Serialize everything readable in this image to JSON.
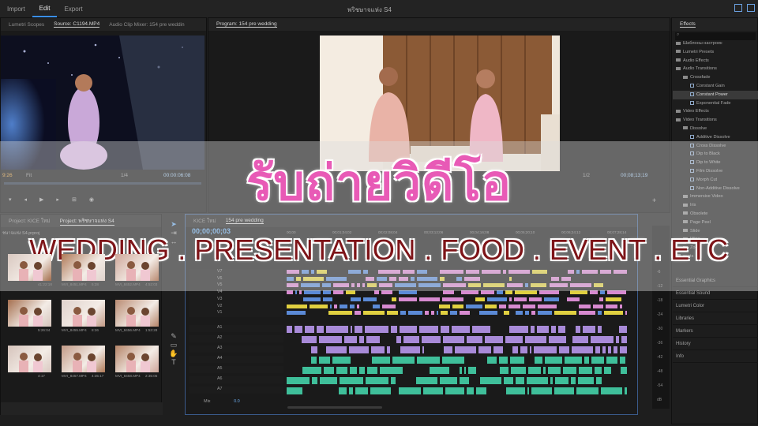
{
  "menu": {
    "items": [
      "Import",
      "Edit",
      "Export"
    ],
    "doc_title": "พริชษาจแห่ง S4"
  },
  "source_panel": {
    "tabs": [
      "Lumetri Scopes",
      "Source: C1194.MP4",
      "Audio Clip Mixer: 154 pre weddin"
    ],
    "timecode_left": "9:26",
    "fit": "Fit",
    "ratio": "1/4",
    "timecode_right": "00:00:06:08"
  },
  "program_panel": {
    "tab": "Program: 154 pre wedding",
    "ratio": "1/2",
    "timecode_right": "00;08;13;19"
  },
  "effects_panel": {
    "title": "Effects",
    "items": [
      {
        "label": "Шаблоны настроек",
        "kind": "folder",
        "indent": 0
      },
      {
        "label": "Lumetri Presets",
        "kind": "folder",
        "indent": 0
      },
      {
        "label": "Audio Effects",
        "kind": "folder",
        "indent": 0
      },
      {
        "label": "Audio Transitions",
        "kind": "folder",
        "indent": 0
      },
      {
        "label": "Crossfade",
        "kind": "folder",
        "indent": 1
      },
      {
        "label": "Constant Gain",
        "kind": "fx",
        "indent": 2
      },
      {
        "label": "Constant Power",
        "kind": "fx",
        "indent": 2,
        "highlight": true
      },
      {
        "label": "Exponential Fade",
        "kind": "fx",
        "indent": 2
      },
      {
        "label": "Video Effects",
        "kind": "folder",
        "indent": 0
      },
      {
        "label": "Video Transitions",
        "kind": "folder",
        "indent": 0
      },
      {
        "label": "Dissolve",
        "kind": "folder",
        "indent": 1
      },
      {
        "label": "Additive Dissolve",
        "kind": "fx",
        "indent": 2
      },
      {
        "label": "Cross Dissolve",
        "kind": "fx",
        "indent": 2
      },
      {
        "label": "Dip to Black",
        "kind": "fx",
        "indent": 2
      },
      {
        "label": "Dip to White",
        "kind": "fx",
        "indent": 2
      },
      {
        "label": "Film Dissolve",
        "kind": "fx",
        "indent": 2
      },
      {
        "label": "Morph Cut",
        "kind": "fx",
        "indent": 2
      },
      {
        "label": "Non-Additive Dissolve",
        "kind": "fx",
        "indent": 2
      },
      {
        "label": "Immersive Video",
        "kind": "folder",
        "indent": 1
      },
      {
        "label": "Iris",
        "kind": "folder",
        "indent": 1
      },
      {
        "label": "Obsolete",
        "kind": "folder",
        "indent": 1
      },
      {
        "label": "Page Peel",
        "kind": "folder",
        "indent": 1
      },
      {
        "label": "Slide",
        "kind": "folder",
        "indent": 1
      },
      {
        "label": "Wipe",
        "kind": "folder",
        "indent": 1
      },
      {
        "label": "Zoom",
        "kind": "folder",
        "indent": 1
      },
      {
        "label": "esets",
        "kind": "folder",
        "indent": 0
      }
    ],
    "side_panels": [
      "Essential Graphics",
      "Essential Sound",
      "Lumetri Color",
      "Libraries",
      "Markers",
      "History",
      "Info"
    ]
  },
  "project_panel": {
    "tabs": [
      "Project: KICE ใหม่",
      "Project: พริชษาจแห่ง S4"
    ],
    "path": "ชษาจแห่ง S4.prproj",
    "clips": [
      {
        "name": "",
        "dur": "41:22:18"
      },
      {
        "name": "MVI_8451.MP4",
        "dur": "5:28"
      },
      {
        "name": "MVI_8452.MP4",
        "dur": "4:52:03"
      },
      {
        "name": "",
        "dur": "5:26:04"
      },
      {
        "name": "MVI_8455.MP4",
        "dur": "8:26"
      },
      {
        "name": "MVI_8456.MP4",
        "dur": "1:53:28"
      },
      {
        "name": "",
        "dur": "4:17"
      },
      {
        "name": "MVI_8457.MP4",
        "dur": "4:35:17"
      },
      {
        "name": "MVI_8458.MP4",
        "dur": "2:35:05"
      }
    ]
  },
  "timeline": {
    "tabs": [
      "KICE ใหม่",
      "154 pre wedding"
    ],
    "timecode": "00;00;00;03",
    "ruler": [
      "00;00",
      "00;01;04;02",
      "00;02;08;04",
      "00;03;12;06",
      "00;04;16;08",
      "00;05;20;10",
      "00;06;24;12",
      "00;07;28;14"
    ],
    "video_tracks": [
      "V7",
      "V6",
      "V5",
      "V4",
      "V3",
      "V2",
      "V1"
    ],
    "audio_tracks": [
      "A1",
      "A2",
      "A3",
      "A4",
      "A5",
      "A6",
      "A7"
    ],
    "mix_label": "Mix",
    "mix_value": "0.0",
    "clip_labels": [
      "TANG8040",
      "TANG",
      "TANG",
      "TANG40",
      "TANG"
    ]
  },
  "meter_ticks": [
    "-6",
    "-12",
    "-18",
    "-24",
    "-30",
    "-36",
    "-42",
    "-48",
    "-54",
    "dB"
  ],
  "overlay": {
    "title": "รับถ่ายวิดีโอ",
    "subtitle": "WEDDING . PRESENTATION . FOOD . EVENT . ETC"
  },
  "colors": {
    "title_pink": "#e85ab6",
    "subtitle_red": "#7e1418",
    "accent_blue": "#3a8ee6",
    "clip_pink": "#d78ad0",
    "clip_green": "#3fbf9a",
    "clip_blue": "#5b8ad6"
  }
}
